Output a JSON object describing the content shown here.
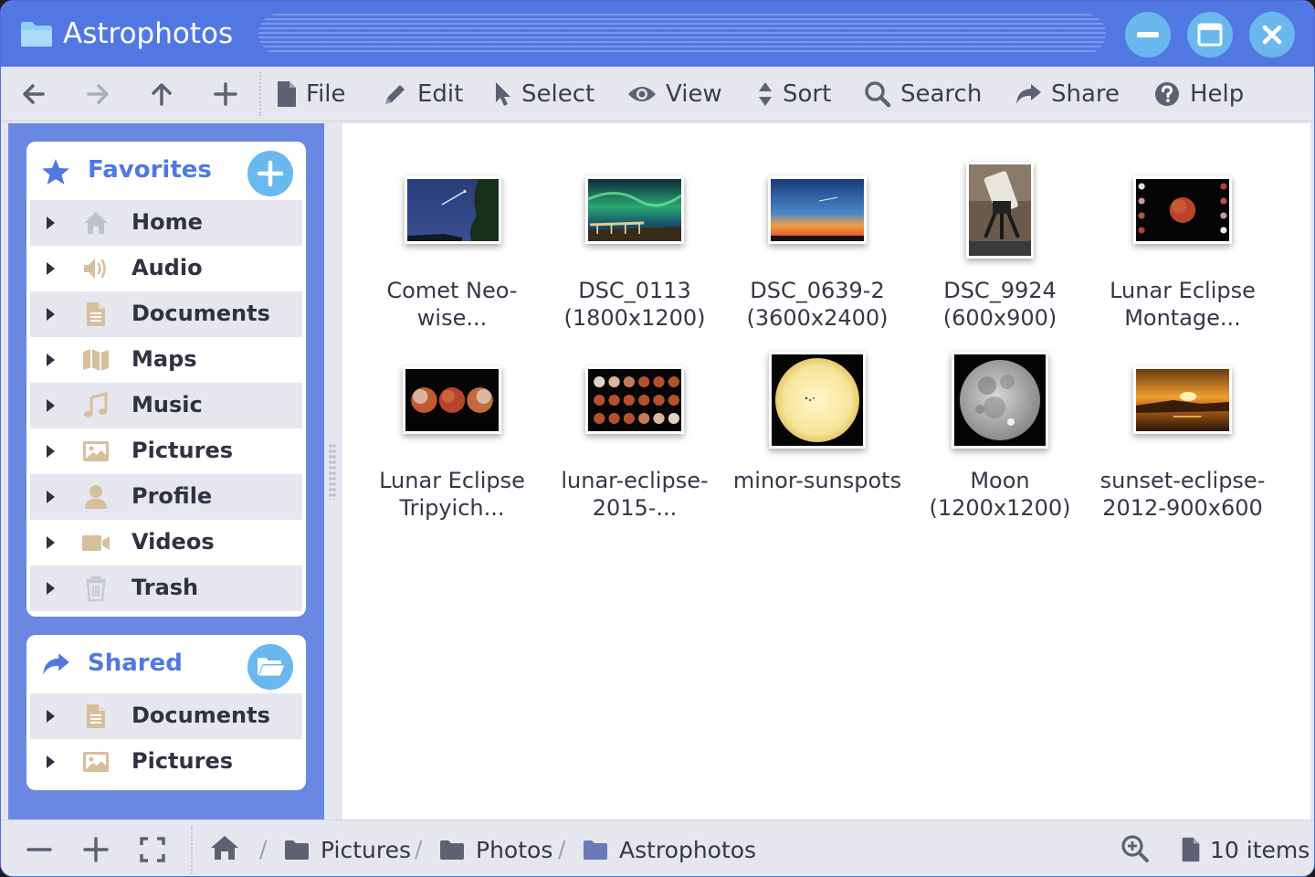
{
  "window": {
    "title": "Astrophotos",
    "controls": {
      "minimize": "minimize-icon",
      "maximize": "maximize-icon",
      "close": "close-icon"
    }
  },
  "toolbar": {
    "nav": [
      "back-icon",
      "forward-icon",
      "up-icon",
      "new-icon"
    ],
    "menu": [
      {
        "label": "File",
        "icon": "file-icon"
      },
      {
        "label": "Edit",
        "icon": "pencil-icon"
      },
      {
        "label": "Select",
        "icon": "cursor-icon"
      },
      {
        "label": "View",
        "icon": "eye-icon"
      },
      {
        "label": "Sort",
        "icon": "sort-icon"
      },
      {
        "label": "Search",
        "icon": "search-icon"
      },
      {
        "label": "Share",
        "icon": "share-icon"
      },
      {
        "label": "Help",
        "icon": "help-icon"
      }
    ]
  },
  "sidebar": {
    "favorites": {
      "title": "Favorites",
      "items": [
        {
          "label": "Home",
          "icon": "home-icon"
        },
        {
          "label": "Audio",
          "icon": "audio-icon"
        },
        {
          "label": "Documents",
          "icon": "document-icon"
        },
        {
          "label": "Maps",
          "icon": "map-icon"
        },
        {
          "label": "Music",
          "icon": "music-icon"
        },
        {
          "label": "Pictures",
          "icon": "picture-icon"
        },
        {
          "label": "Profile",
          "icon": "profile-icon"
        },
        {
          "label": "Videos",
          "icon": "video-icon"
        },
        {
          "label": "Trash",
          "icon": "trash-icon"
        }
      ]
    },
    "shared": {
      "title": "Shared",
      "items": [
        {
          "label": "Documents",
          "icon": "document-icon"
        },
        {
          "label": "Pictures",
          "icon": "picture-icon"
        }
      ]
    }
  },
  "files": [
    {
      "line1": "Comet Neo-",
      "line2": "wise..."
    },
    {
      "line1": "DSC_0113",
      "line2": "(1800x1200)"
    },
    {
      "line1": "DSC_0639-2",
      "line2": "(3600x2400)"
    },
    {
      "line1": "DSC_9924",
      "line2": "(600x900)"
    },
    {
      "line1": "Lunar Eclipse",
      "line2": "Montage..."
    },
    {
      "line1": "Lunar Eclipse",
      "line2": "Tripyich..."
    },
    {
      "line1": "lunar-eclipse-",
      "line2": "2015-..."
    },
    {
      "line1": "minor-sunspots",
      "line2": ""
    },
    {
      "line1": "Moon",
      "line2": "(1200x1200)"
    },
    {
      "line1": "sunset-eclipse-",
      "line2": "2012-900x600"
    }
  ],
  "status": {
    "breadcrumb": [
      "Pictures",
      "Photos",
      "Astrophotos"
    ],
    "count": "10 items"
  },
  "colors": {
    "accent": "#5178e2",
    "sidebar": "#6a88e2",
    "button": "#6ab8ee",
    "icon_tan": "#d6c09c"
  }
}
